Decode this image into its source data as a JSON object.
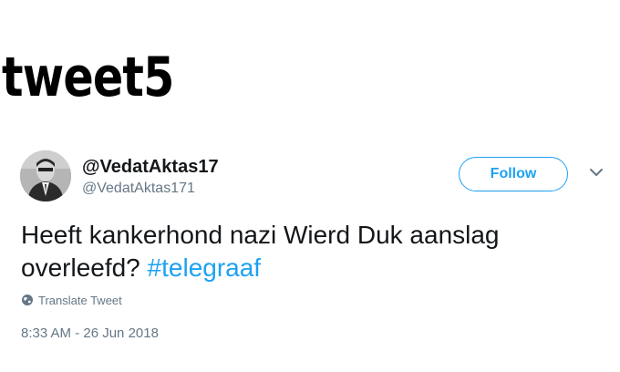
{
  "page": {
    "heading": "tweet5"
  },
  "tweet": {
    "display_name": "@VedatAktas17",
    "handle": "@VedatAktas171",
    "follow_label": "Follow",
    "text": "Heeft kankerhond nazi Wierd Duk aanslag overleefd?",
    "hashtag": "#telegraaf",
    "translate_label": "Translate Tweet",
    "timestamp": "8:33 AM - 26 Jun 2018"
  },
  "colors": {
    "accent": "#1da1f2",
    "secondary_text": "#657786",
    "primary_text": "#14171a"
  },
  "icons": {
    "globe": "globe-icon",
    "chevron": "chevron-down-icon"
  }
}
